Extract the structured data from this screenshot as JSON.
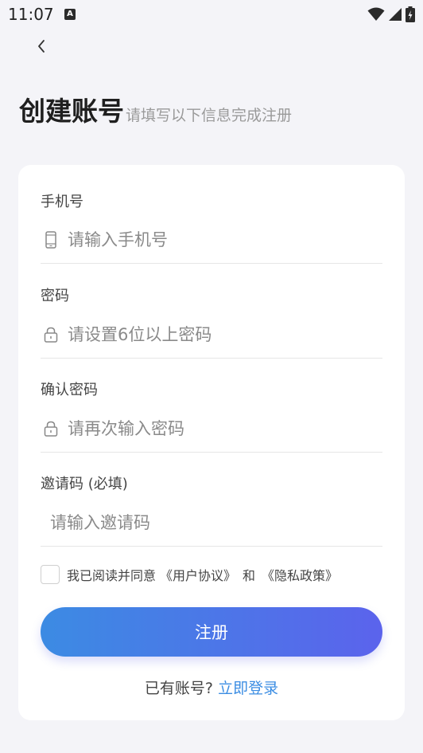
{
  "status_bar": {
    "time": "11:07",
    "notification_badge": "A"
  },
  "header": {
    "title": "创建账号",
    "subtitle": "请填写以下信息完成注册"
  },
  "form": {
    "phone": {
      "label": "手机号",
      "placeholder": "请输入手机号",
      "icon": "phone-icon"
    },
    "password": {
      "label": "密码",
      "placeholder": "请设置6位以上密码",
      "icon": "lock-icon"
    },
    "confirm_password": {
      "label": "确认密码",
      "placeholder": "请再次输入密码",
      "icon": "lock-icon"
    },
    "invite_code": {
      "label": "邀请码 (必填)",
      "placeholder": "请输入邀请码"
    }
  },
  "agreement": {
    "text": "我已阅读并同意",
    "terms_link": "《用户协议》",
    "and": "和",
    "privacy_link": "《隐私政策》"
  },
  "submit_button": {
    "label": "注册"
  },
  "login_prompt": {
    "text": "已有账号?",
    "link": "立即登录"
  },
  "colors": {
    "accent_start": "#3c8be3",
    "accent_end": "#5b63ec",
    "link": "#3b8de3"
  }
}
